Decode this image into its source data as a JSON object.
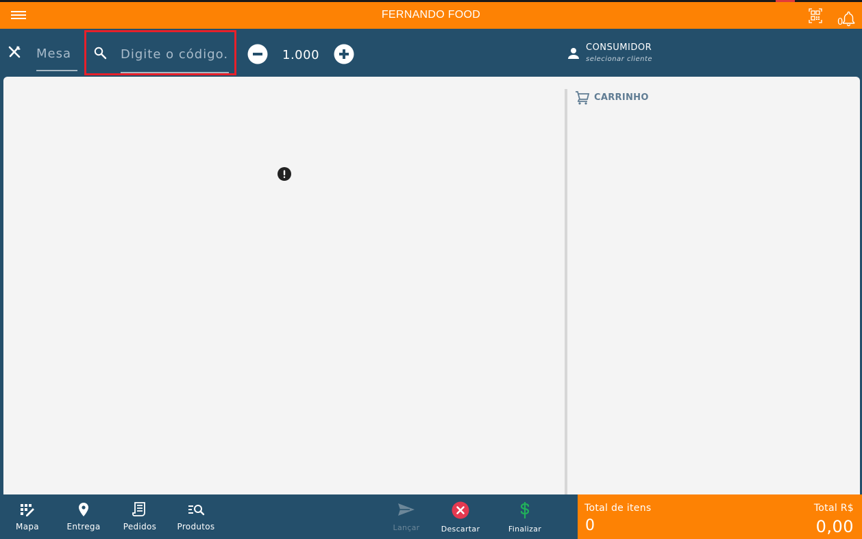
{
  "header": {
    "title": "FERNANDO FOOD",
    "notification_count": "0"
  },
  "toolbar": {
    "mesa_placeholder": "Mesa",
    "search_placeholder": "Digite o código...",
    "quantity": "1.000",
    "customer_label": "CONSUMIDOR",
    "customer_sub": "selecionar cliente"
  },
  "cart": {
    "title": "CARRINHO"
  },
  "bottom_nav": {
    "items": [
      {
        "label": "Mapa",
        "icon": "map-grid-icon"
      },
      {
        "label": "Entrega",
        "icon": "location-pin-icon"
      },
      {
        "label": "Pedidos",
        "icon": "receipt-icon"
      },
      {
        "label": "Produtos",
        "icon": "product-search-icon"
      }
    ],
    "actions": [
      {
        "label": "Lançar",
        "icon": "send-icon",
        "enabled": false
      },
      {
        "label": "Descartar",
        "icon": "discard-icon",
        "enabled": true
      },
      {
        "label": "Finalizar",
        "icon": "dollar-icon",
        "enabled": true
      }
    ]
  },
  "totals": {
    "items_label": "Total de itens",
    "items_value": "0",
    "amount_label": "Total R$",
    "amount_value": "0,00"
  },
  "colors": {
    "primary_orange": "#fd8204",
    "navy": "#244f6b",
    "discard_red": "#e53950",
    "finalize_green": "#21b05a"
  }
}
